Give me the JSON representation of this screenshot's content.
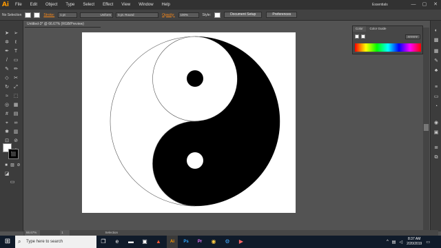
{
  "app": {
    "logo": "Ai"
  },
  "menu": [
    "File",
    "Edit",
    "Object",
    "Type",
    "Select",
    "Effect",
    "View",
    "Window",
    "Help"
  ],
  "workspace": "Essentials",
  "window_controls": [
    "—",
    "▢",
    "✕"
  ],
  "control_bar": {
    "selection": "No Selection",
    "stroke_label": "Stroke:",
    "stroke_weight": "1 pt",
    "stroke_profile": "Uniform",
    "brush": "5 pt. Round",
    "opacity_label": "Opacity:",
    "opacity": "100%",
    "style_label": "Style:",
    "document_setup": "Document Setup",
    "preferences": "Preferences"
  },
  "document": {
    "tab": "Untitled-3* @ 66.67% (RGB/Preview)"
  },
  "color_panel": {
    "tabs": [
      "Color",
      "Color Guide"
    ],
    "hex": "FFFFFF"
  },
  "status": {
    "zoom": "66.67%",
    "artboard": "1",
    "tool": "Selection"
  },
  "taskbar": {
    "search_placeholder": "Type here to search",
    "time": "8:37 AM",
    "date": "2/20/2019"
  },
  "colors": {
    "accent": "#ff9a00",
    "artboard": "#ffffff",
    "yin": "#000000",
    "yang": "#ffffff"
  }
}
